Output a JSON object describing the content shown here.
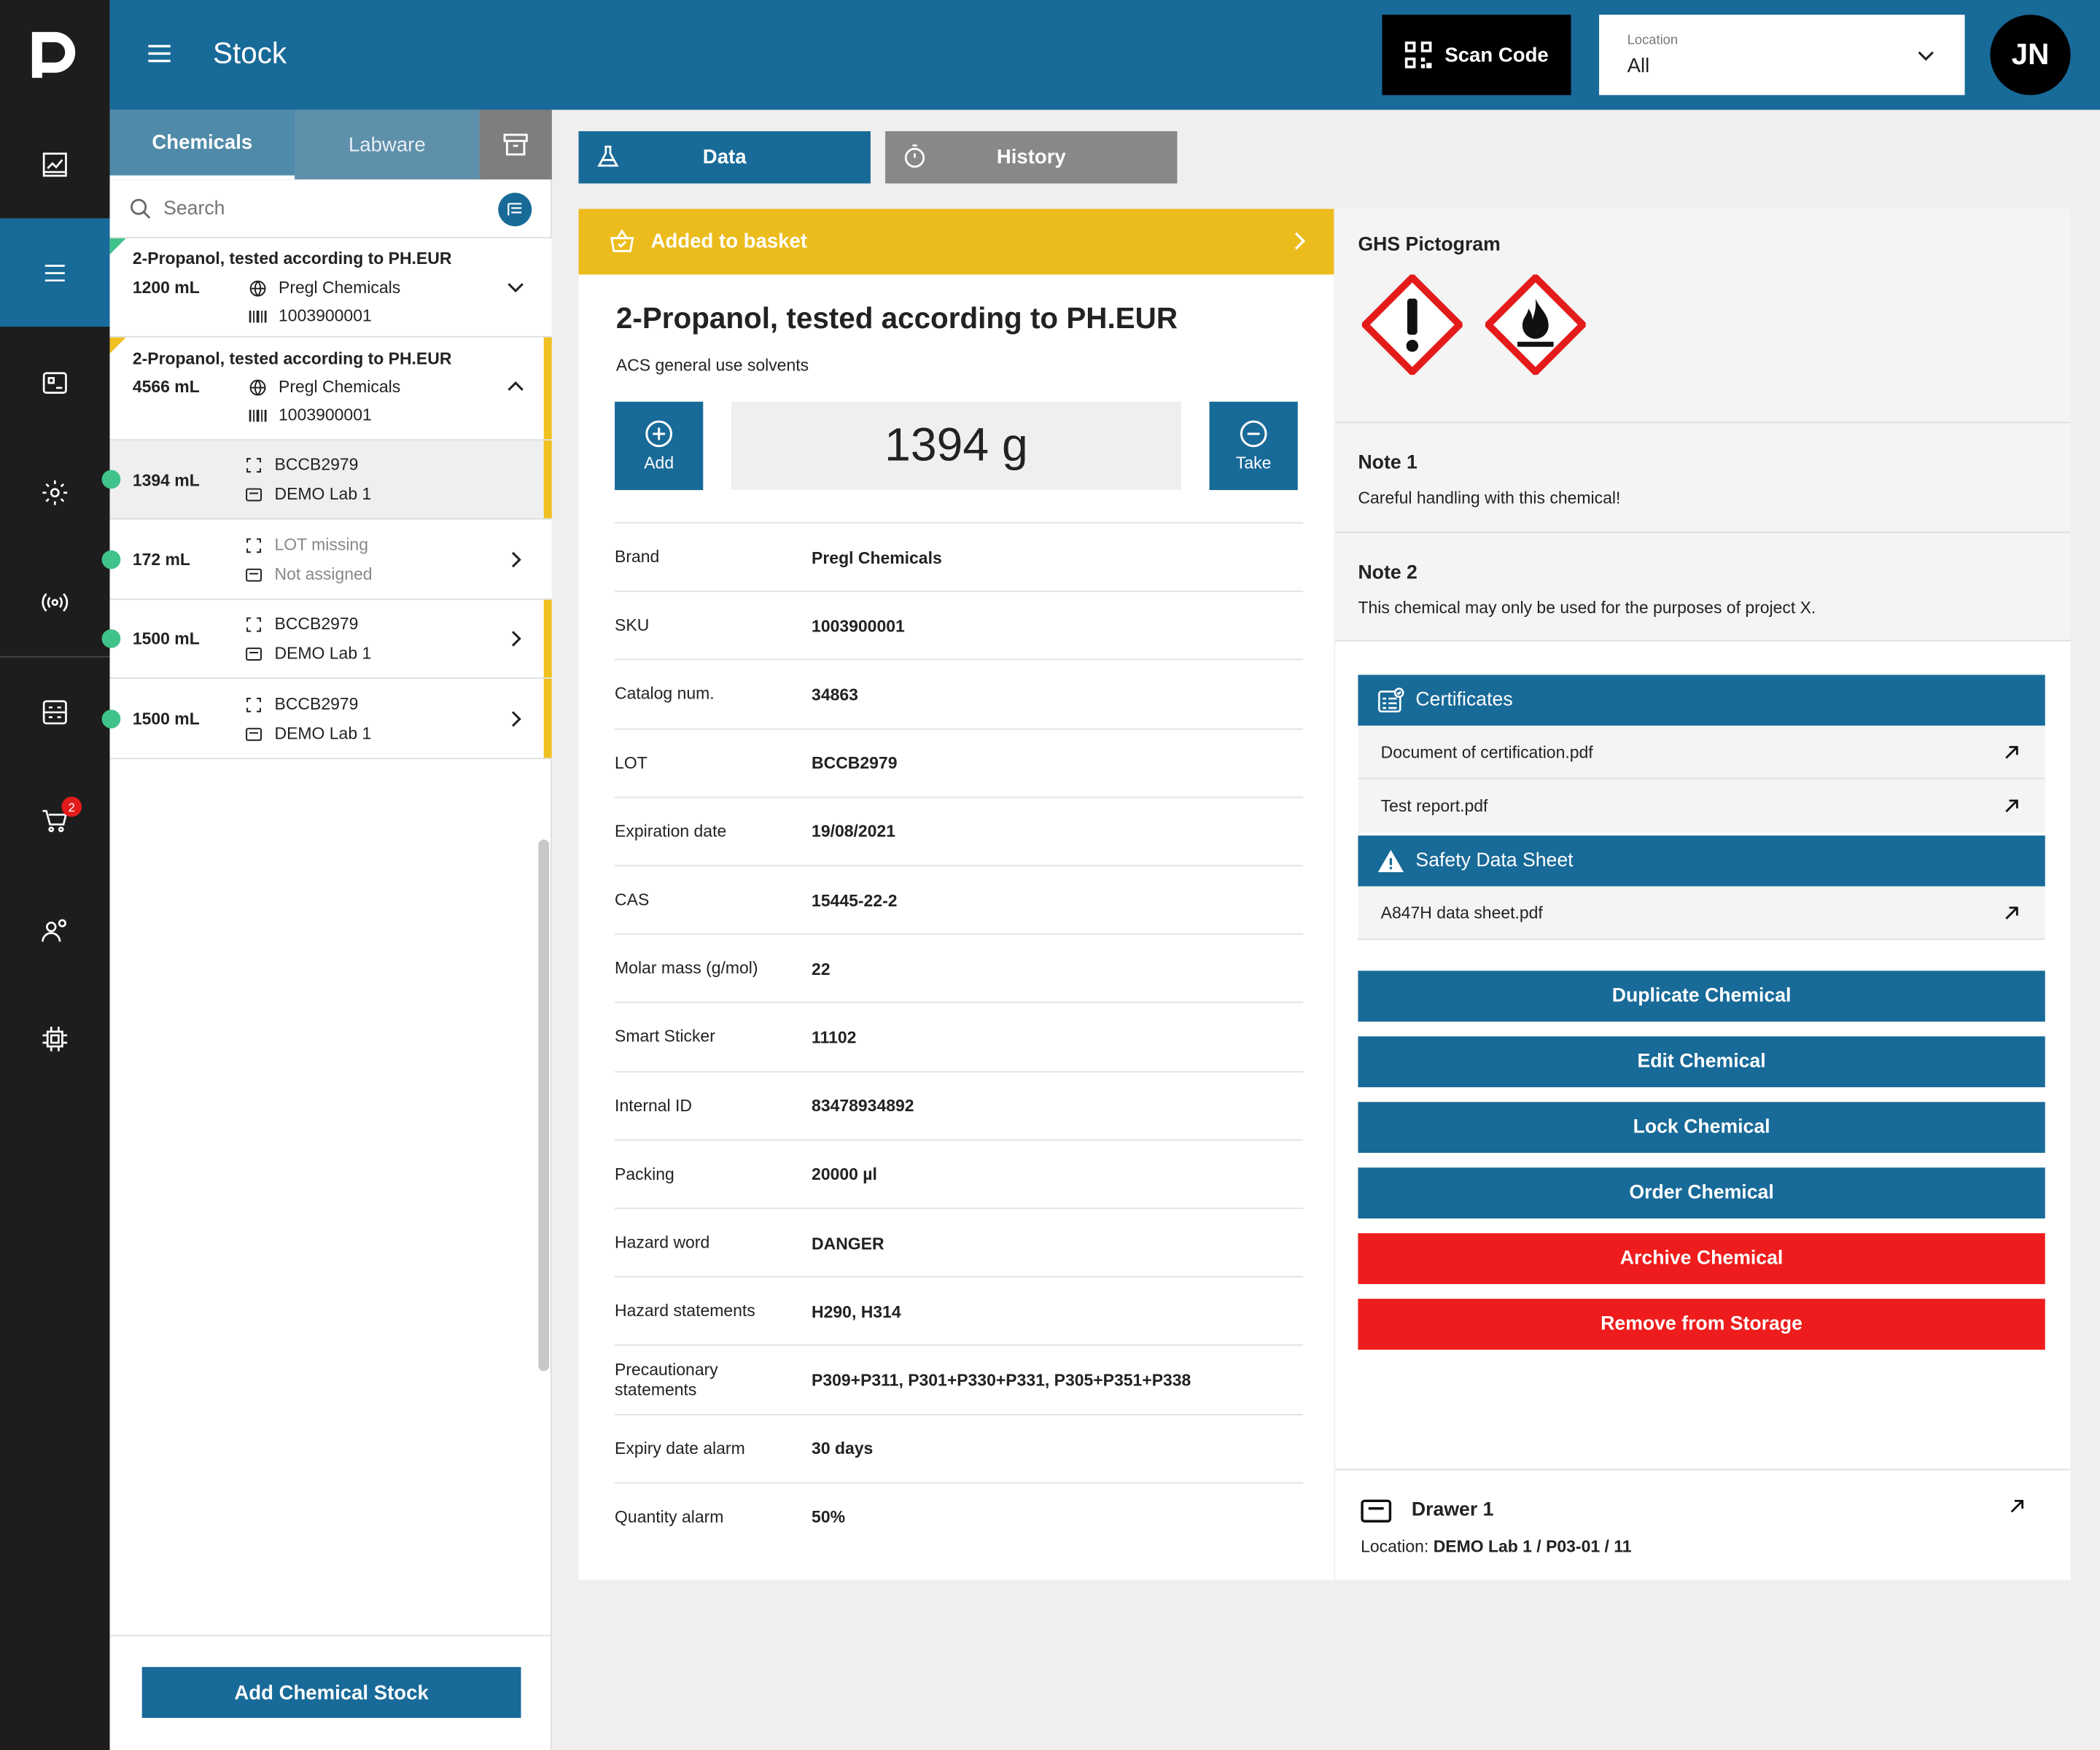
{
  "header": {
    "title": "Stock",
    "scan_label": "Scan Code",
    "location_label": "Location",
    "location_value": "All",
    "avatar_initials": "JN"
  },
  "rail": {
    "items": [
      "logo-icon",
      "dashboard-icon",
      "list-icon",
      "storage-icon",
      "settings-gear-icon",
      "sensor-icon",
      "report-icon",
      "cart-icon",
      "user-settings-icon",
      "chip-icon"
    ],
    "cart_badge": "2"
  },
  "list": {
    "tabs": [
      "Chemicals",
      "Labware"
    ],
    "search_placeholder": "Search",
    "groups": [
      {
        "name": "2-Propanol, tested according to PH.EUR",
        "qty": "1200 mL",
        "brand": "Pregl Chemicals",
        "code": "1003900001"
      },
      {
        "name": "2-Propanol, tested according to PH.EUR",
        "qty": "4566 mL",
        "brand": "Pregl Chemicals",
        "code": "1003900001"
      }
    ],
    "items": [
      {
        "qty": "1394 mL",
        "lot": "BCCB2979",
        "location": "DEMO Lab 1"
      },
      {
        "qty": "172 mL",
        "lot": "LOT missing",
        "location": "Not assigned"
      },
      {
        "qty": "1500 mL",
        "lot": "BCCB2979",
        "location": "DEMO Lab 1"
      },
      {
        "qty": "1500 mL",
        "lot": "BCCB2979",
        "location": "DEMO Lab 1"
      }
    ],
    "add_button": "Add Chemical Stock"
  },
  "view_tabs": {
    "data": "Data",
    "history": "History"
  },
  "detail": {
    "basket": "Added to basket",
    "title": "2-Propanol, tested according to PH.EUR",
    "subtitle": "ACS general use solvents",
    "add_label": "Add",
    "take_label": "Take",
    "quantity": "1394 g",
    "props": [
      {
        "k": "Brand",
        "v": "Pregl Chemicals"
      },
      {
        "k": "SKU",
        "v": "1003900001"
      },
      {
        "k": "Catalog num.",
        "v": "34863"
      },
      {
        "k": "LOT",
        "v": "BCCB2979"
      },
      {
        "k": "Expiration date",
        "v": "19/08/2021"
      },
      {
        "k": "CAS",
        "v": "15445-22-2"
      },
      {
        "k": "Molar mass (g/mol)",
        "v": "22"
      },
      {
        "k": "Smart Sticker",
        "v": "11102"
      },
      {
        "k": "Internal ID",
        "v": "83478934892"
      },
      {
        "k": "Packing",
        "v": "20000 µl"
      },
      {
        "k": "Hazard word",
        "v": "DANGER"
      },
      {
        "k": "Hazard statements",
        "v": "H290, H314"
      },
      {
        "k": "Precautionary statements",
        "v": "P309+P311, P301+P330+P331, P305+P351+P338"
      },
      {
        "k": "Expiry date alarm",
        "v": "30 days"
      },
      {
        "k": "Quantity alarm",
        "v": "50%"
      }
    ]
  },
  "side": {
    "ghs_title": "GHS Pictogram",
    "notes": [
      {
        "title": "Note 1",
        "body": "Careful handling with this chemical!"
      },
      {
        "title": "Note 2",
        "body": "This chemical may only be used for the purposes of project X."
      }
    ],
    "certificates_title": "Certificates",
    "certificates": [
      "Document of certification.pdf",
      "Test report.pdf"
    ],
    "sds_title": "Safety Data Sheet",
    "sds_files": [
      "A847H data sheet.pdf"
    ],
    "actions": [
      "Duplicate Chemical",
      "Edit Chemical",
      "Lock Chemical",
      "Order Chemical",
      "Archive Chemical",
      "Remove from Storage"
    ],
    "drawer_title": "Drawer 1",
    "drawer_location_label": "Location:",
    "drawer_location": "DEMO Lab 1 / P03-01 / 11"
  },
  "colors": {
    "primary": "#186a98",
    "basket": "#ecbc1d",
    "danger": "#ee1c1c",
    "rail": "#1d1d1d",
    "status_green": "#3fc38a"
  }
}
